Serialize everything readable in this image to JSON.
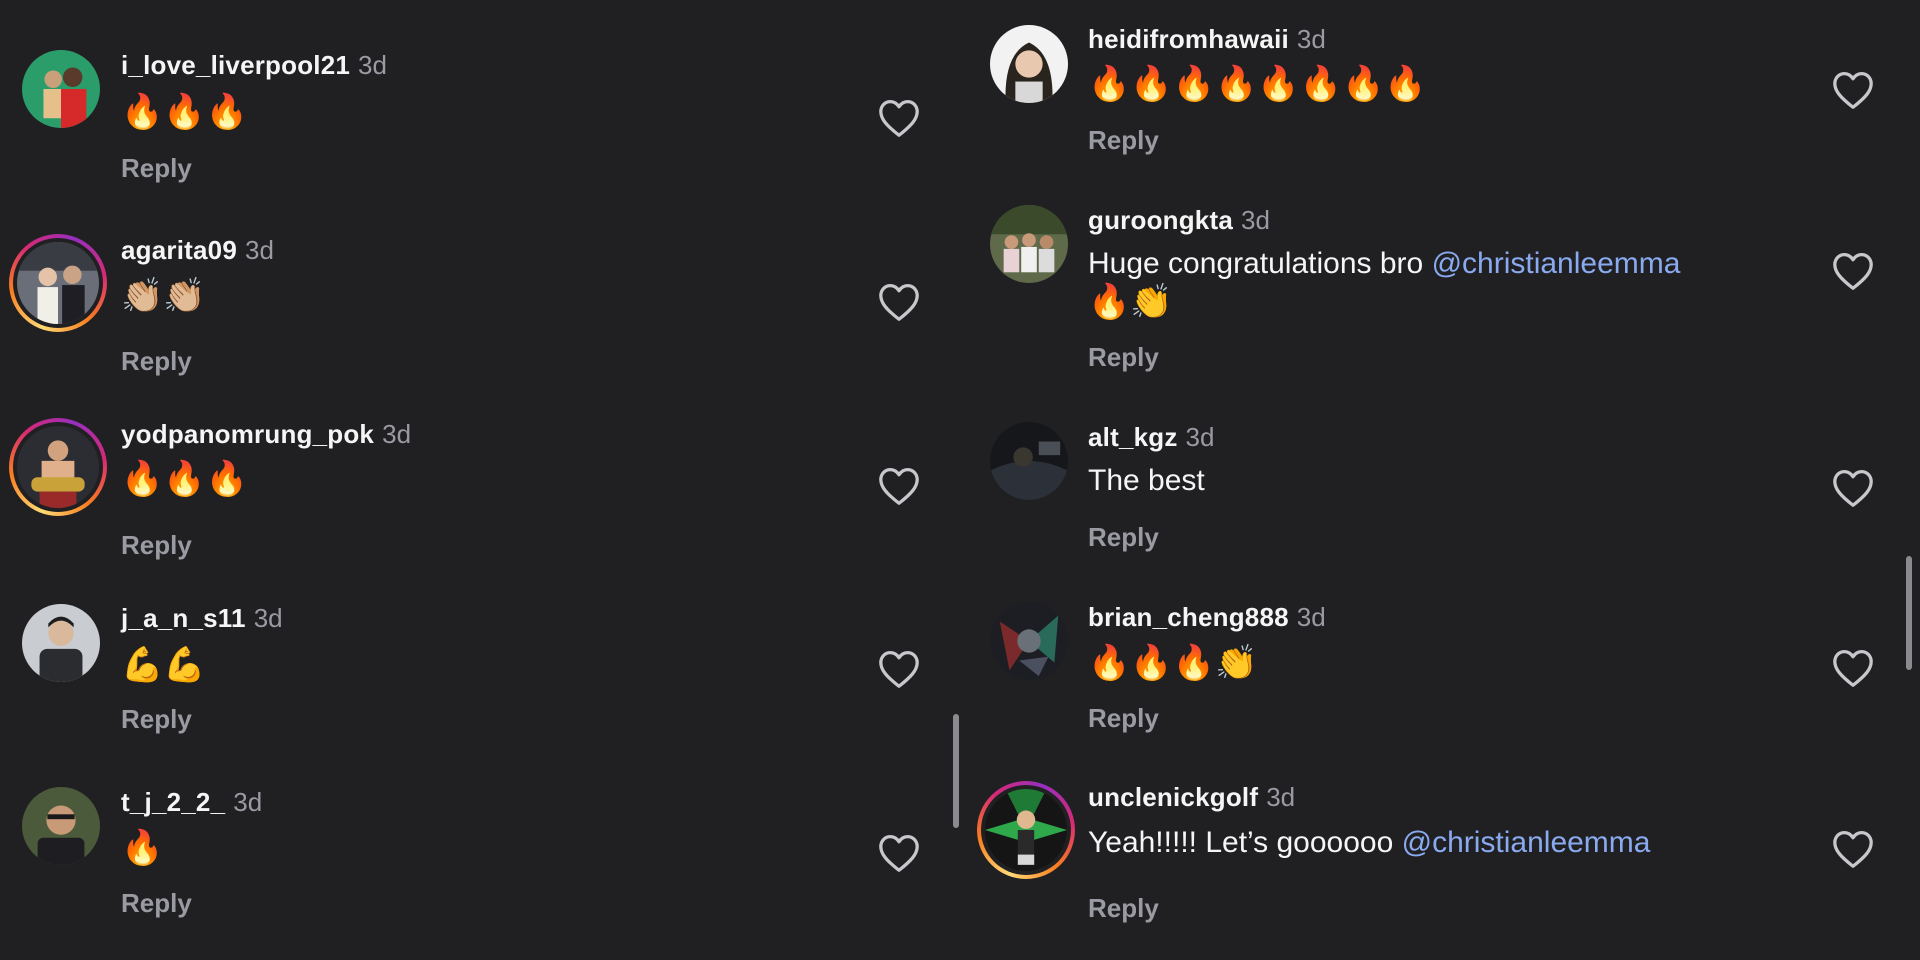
{
  "left_comments": [
    {
      "username": "i_love_liverpool21",
      "time": "3d",
      "text": "🔥🔥🔥",
      "reply": "Reply"
    },
    {
      "username": "agarita09",
      "time": "3d",
      "text": "👏🏼👏🏼",
      "reply": "Reply"
    },
    {
      "username": "yodpanomrung_pok",
      "time": "3d",
      "text": "🔥🔥🔥",
      "reply": "Reply"
    },
    {
      "username": "j_a_n_s11",
      "time": "3d",
      "text": "💪💪",
      "reply": "Reply"
    },
    {
      "username": "t_j_2_2_",
      "time": "3d",
      "text": "🔥",
      "reply": "Reply"
    }
  ],
  "right_comments": [
    {
      "username": "heidifromhawaii",
      "time": "3d",
      "text": "🔥🔥🔥🔥🔥🔥🔥🔥",
      "reply": "Reply"
    },
    {
      "username": "guroongkta",
      "time": "3d",
      "text": "Huge congratulations bro ",
      "mention": "@christianleemma",
      "text2": "🔥👏",
      "reply": "Reply"
    },
    {
      "username": "alt_kgz",
      "time": "3d",
      "text": "The best",
      "reply": "Reply"
    },
    {
      "username": "brian_cheng888",
      "time": "3d",
      "text": "🔥🔥🔥👏",
      "reply": "Reply"
    },
    {
      "username": "unclenickgolf",
      "time": "3d",
      "text": "Yeah!!!!! Let’s goooooo ",
      "mention": "@christianleemma",
      "reply": "Reply"
    }
  ],
  "colors": {
    "background": "#202023",
    "text": "#f5f5f5",
    "muted": "#9a9aa2",
    "mention": "#8aaaf0"
  },
  "icons": {
    "like": "heart-outline-icon"
  }
}
